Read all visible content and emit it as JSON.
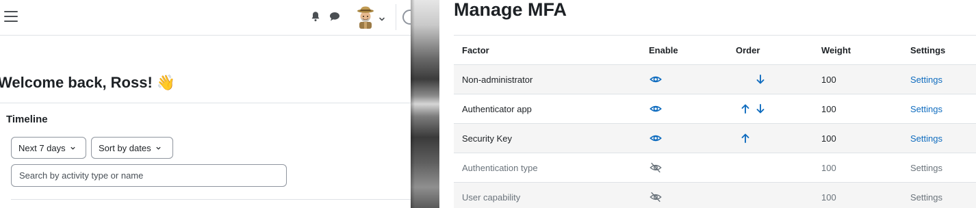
{
  "dashboard": {
    "welcome_text": "Welcome back, Ross!",
    "wave_emoji": "👋",
    "icons": {
      "menu": "hamburger-menu-icon",
      "notifications": "bell-icon",
      "messages": "chat-bubble-icon",
      "avatar": "user-avatar",
      "user_menu_toggle": "chevron-down-icon"
    },
    "timeline": {
      "title": "Timeline",
      "filter_label": "Next 7 days",
      "sort_label": "Sort by dates",
      "search_placeholder": "Search by activity type or name"
    }
  },
  "mfa": {
    "title": "Manage MFA",
    "columns": [
      "Factor",
      "Enable",
      "Order",
      "Weight",
      "Settings"
    ],
    "rows": [
      {
        "factor": "Non-administrator",
        "enabled": true,
        "order": [
          "down"
        ],
        "weight": "100",
        "settings": "Settings"
      },
      {
        "factor": "Authenticator app",
        "enabled": true,
        "order": [
          "up",
          "down"
        ],
        "weight": "100",
        "settings": "Settings"
      },
      {
        "factor": "Security Key",
        "enabled": true,
        "order": [
          "up"
        ],
        "weight": "100",
        "settings": "Settings"
      },
      {
        "factor": "Authentication type",
        "enabled": false,
        "order": [],
        "weight": "100",
        "settings": "Settings"
      },
      {
        "factor": "User capability",
        "enabled": false,
        "order": [],
        "weight": "100",
        "settings": "Settings"
      }
    ],
    "colors": {
      "link": "#0f6cbf",
      "muted_text": "#6a737b",
      "stripe": "#f5f5f5"
    }
  }
}
